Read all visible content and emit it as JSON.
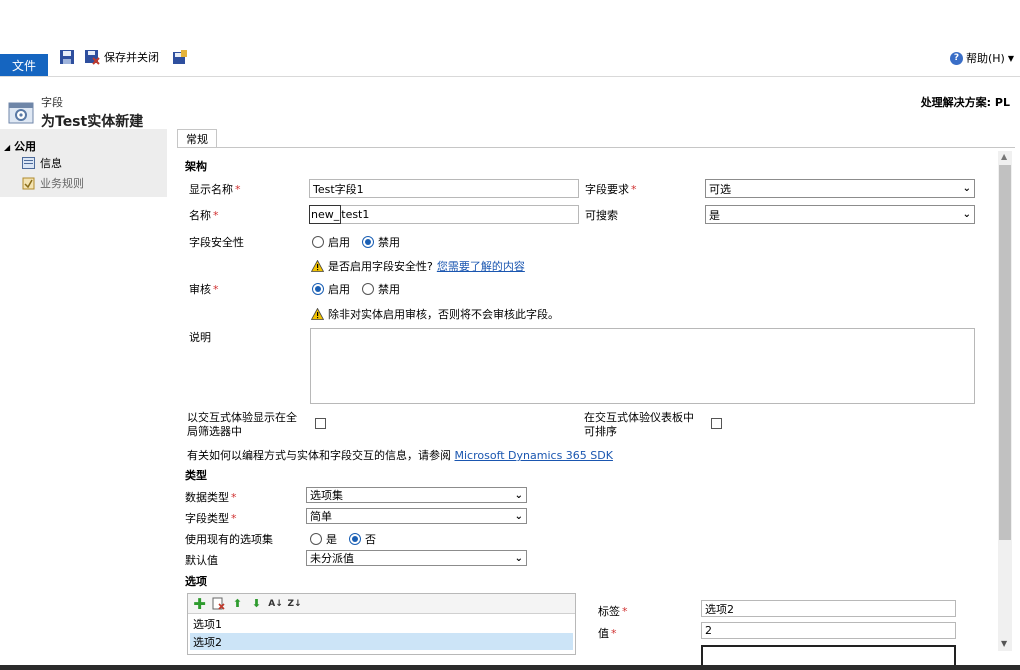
{
  "ribbon": {
    "file_tab": "文件",
    "save_close_label": "保存并关闭",
    "help_label": "帮助(H)"
  },
  "header": {
    "breadcrumb": "字段",
    "title": "为Test实体新建",
    "solution_label": "处理解决方案: PL"
  },
  "sidebar": {
    "group": "公用",
    "items": [
      {
        "label": "信息",
        "icon": "info-list-icon"
      },
      {
        "label": "业务规则",
        "icon": "business-rules-icon"
      }
    ]
  },
  "tab": {
    "label": "常规"
  },
  "schema": {
    "section": "架构",
    "display_name": {
      "label": "显示名称",
      "value": "Test字段1"
    },
    "field_requirement": {
      "label": "字段要求",
      "value": "可选"
    },
    "name": {
      "label": "名称",
      "prefix": "new_",
      "value": "test1"
    },
    "searchable": {
      "label": "可搜索",
      "value": "是"
    },
    "field_security": {
      "label": "字段安全性",
      "options": [
        "启用",
        "禁用"
      ],
      "selected": "禁用"
    },
    "security_warning": "是否启用字段安全性?",
    "security_link": "您需要了解的内容",
    "auditing": {
      "label": "审核",
      "options": [
        "启用",
        "禁用"
      ],
      "selected": "启用"
    },
    "audit_warning": "除非对实体启用审核，否则将不会审核此字段。",
    "description": {
      "label": "说明",
      "value": ""
    },
    "global_filter": {
      "label": "以交互式体验显示在全局筛选器中",
      "checked": false
    },
    "sortable": {
      "label": "在交互式体验仪表板中可排序",
      "checked": false
    },
    "sdk_text": "有关如何以编程方式与实体和字段交互的信息，请参阅",
    "sdk_link": "Microsoft Dynamics 365 SDK"
  },
  "type": {
    "section": "类型",
    "data_type": {
      "label": "数据类型",
      "value": "选项集"
    },
    "field_type": {
      "label": "字段类型",
      "value": "简单"
    },
    "use_existing": {
      "label": "使用现有的选项集",
      "options": [
        "是",
        "否"
      ],
      "selected": "否"
    },
    "default_value": {
      "label": "默认值",
      "value": "未分派值"
    }
  },
  "options": {
    "section": "选项",
    "items": [
      "选项1",
      "选项2"
    ],
    "selected": "选项2",
    "label_field": {
      "label": "标签",
      "value": "选项2"
    },
    "value_field": {
      "label": "值",
      "value": "2"
    }
  }
}
